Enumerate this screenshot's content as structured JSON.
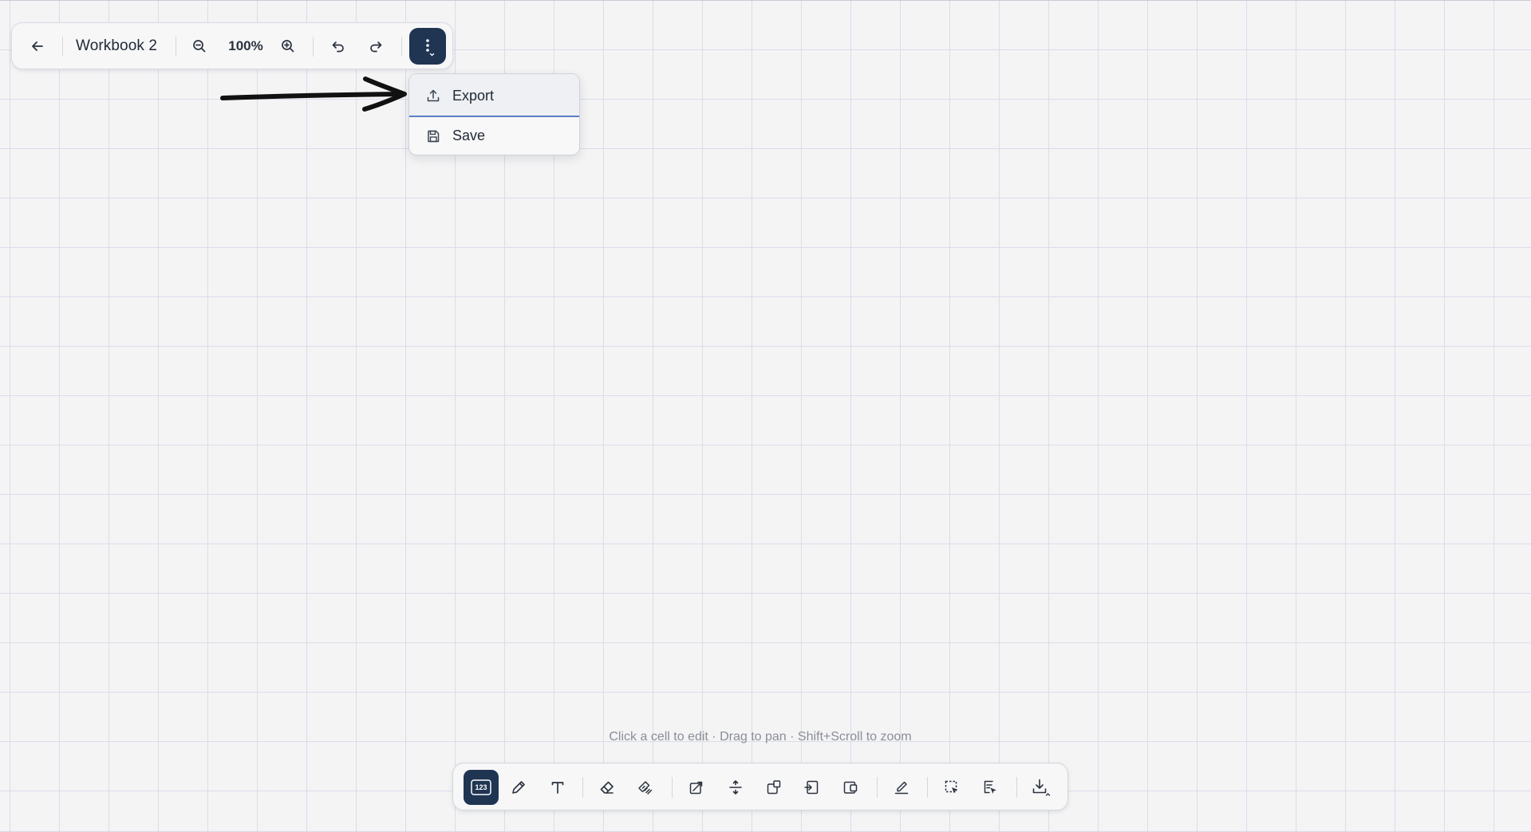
{
  "toolbar": {
    "title": "Workbook 2",
    "zoom_level": "100%",
    "icons": [
      "back-arrow-icon",
      "zoom-out-icon",
      "zoom-in-icon",
      "undo-icon",
      "redo-icon",
      "more-vertical-icon"
    ]
  },
  "menu": {
    "items": [
      {
        "label": "Export",
        "icon": "upload-icon",
        "highlighted": true
      },
      {
        "label": "Save",
        "icon": "floppy-disk-icon",
        "highlighted": false
      }
    ]
  },
  "hint": {
    "text": "Click a cell to edit · Drag to pan · Shift+Scroll to zoom"
  },
  "bottom_toolbar": {
    "active_tool": "number-tool",
    "numbers_badge": "123",
    "tools": [
      "number-tool",
      "pencil-tool",
      "text-tool",
      "eraser-tool",
      "eraser-lines-tool",
      "shape-tool",
      "divide-tool",
      "add-box-tool",
      "insert-left-tool",
      "insert-right-tool",
      "signature-tool",
      "select-area-tool",
      "export-selection-tool",
      "download-tool"
    ]
  },
  "colors": {
    "accent": "#1f3552",
    "canvas_background": "#f4f4f5",
    "grid_line": "#dadcea",
    "menu_divider": "#5b7ec6",
    "hint_text": "#8a8e96"
  }
}
